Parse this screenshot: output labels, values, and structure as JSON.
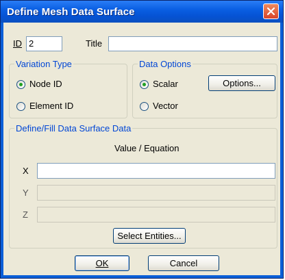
{
  "window": {
    "title": "Define Mesh Data Surface"
  },
  "header": {
    "id_label": "ID",
    "id_value": "2",
    "title_label": "Title",
    "title_value": ""
  },
  "variation_type": {
    "title": "Variation Type",
    "options": [
      {
        "label": "Node ID",
        "checked": true
      },
      {
        "label": "Element ID",
        "checked": false
      }
    ]
  },
  "data_options": {
    "title": "Data Options",
    "options": [
      {
        "label": "Scalar",
        "checked": true
      },
      {
        "label": "Vector",
        "checked": false
      }
    ],
    "options_button": "Options..."
  },
  "define_fill": {
    "title": "Define/Fill Data Surface Data",
    "column_header": "Value / Equation",
    "rows": [
      {
        "label": "X",
        "value": "",
        "enabled": true
      },
      {
        "label": "Y",
        "value": "",
        "enabled": false
      },
      {
        "label": "Z",
        "value": "",
        "enabled": false
      }
    ],
    "select_button": "Select Entities..."
  },
  "footer": {
    "ok_label": "OK",
    "cancel_label": "Cancel"
  },
  "colors": {
    "titlebar": "#0a5fe3",
    "dialog_bg": "#ece9d8",
    "group_title": "#0046d5",
    "radio_dot": "#21a121"
  }
}
